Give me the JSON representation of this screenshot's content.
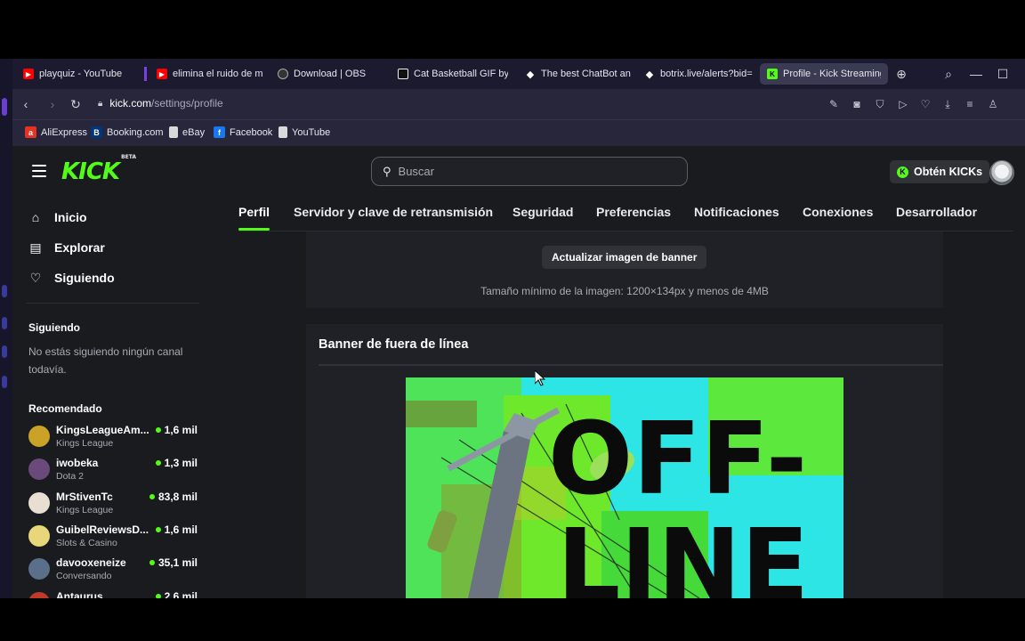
{
  "browser": {
    "tabs": [
      {
        "label": "playquiz - YouTube",
        "icon": "youtube-icon",
        "color": "#ff0000"
      },
      {
        "label": "elimina el ruido de micró",
        "icon": "youtube-icon",
        "color": "#ff0000"
      },
      {
        "label": "Download | OBS",
        "icon": "obs-icon",
        "color": "#444444"
      },
      {
        "label": "Cat Basketball GIF by sill",
        "icon": "giphy-icon",
        "color": "#ffffff"
      },
      {
        "label": "The best ChatBot and W",
        "icon": "botrix-icon",
        "color": "#ffffff"
      },
      {
        "label": "botrix.live/alerts?bid=Dn",
        "icon": "botrix-icon",
        "color": "#ffffff"
      },
      {
        "label": "Profile - Kick Streaming",
        "icon": "kick-icon",
        "color": "#53fc18"
      }
    ],
    "url_host": "kick.com",
    "url_path": "/settings/profile",
    "bookmarks": [
      {
        "label": "AliExpress",
        "icon": "aliexpress-icon",
        "color": "#e43225"
      },
      {
        "label": "Booking.com",
        "icon": "booking-icon",
        "color": "#003580"
      },
      {
        "label": "eBay",
        "icon": "page-icon",
        "color": "#d9d9d9"
      },
      {
        "label": "Facebook",
        "icon": "facebook-icon",
        "color": "#1877f2"
      },
      {
        "label": "YouTube",
        "icon": "page-icon",
        "color": "#d9d9d9"
      }
    ]
  },
  "header": {
    "logo": "KICK",
    "logo_badge": "BETA",
    "search_placeholder": "Buscar",
    "get_kicks": "Obtén KICKs"
  },
  "sidebar": {
    "nav": [
      {
        "label": "Inicio",
        "icon": "home-icon"
      },
      {
        "label": "Explorar",
        "icon": "browse-icon"
      },
      {
        "label": "Siguiendo",
        "icon": "heart-icon"
      }
    ],
    "following_heading": "Siguiendo",
    "following_note": "No estás siguiendo ningún canal todavía.",
    "recommended_heading": "Recomendado",
    "recommended": [
      {
        "name": "KingsLeagueAm...",
        "category": "Kings League",
        "viewers": "1,6 mil",
        "avatar_color": "#c9a227"
      },
      {
        "name": "iwobeka",
        "category": "Dota 2",
        "viewers": "1,3 mil",
        "avatar_color": "#6a4a7a"
      },
      {
        "name": "MrStivenTc",
        "category": "Kings League",
        "viewers": "83,8 mil",
        "avatar_color": "#e8dfd2"
      },
      {
        "name": "GuibelReviewsD...",
        "category": "Slots & Casino",
        "viewers": "1,6 mil",
        "avatar_color": "#e7d77a"
      },
      {
        "name": "davooxeneize",
        "category": "Conversando",
        "viewers": "35,1 mil",
        "avatar_color": "#5a6f8a"
      },
      {
        "name": "Antaurus",
        "category": "",
        "viewers": "2,6 mil",
        "avatar_color": "#c0392b"
      }
    ]
  },
  "settings_tabs": [
    "Perfil",
    "Servidor y clave de retransmisión",
    "Seguridad",
    "Preferencias",
    "Notificaciones",
    "Conexiones",
    "Desarrollador"
  ],
  "banner_section": {
    "update_button": "Actualizar imagen de banner",
    "size_note": "Tamaño mínimo de la imagen: 1200×134px y menos de 4MB"
  },
  "offline_section": {
    "title": "Banner de fuera de línea",
    "image_text_line1": "OFF-",
    "image_text_line2": "LINE"
  },
  "colors": {
    "accent": "#53fc18",
    "bg": "#191b1f",
    "card": "#1f2126"
  }
}
